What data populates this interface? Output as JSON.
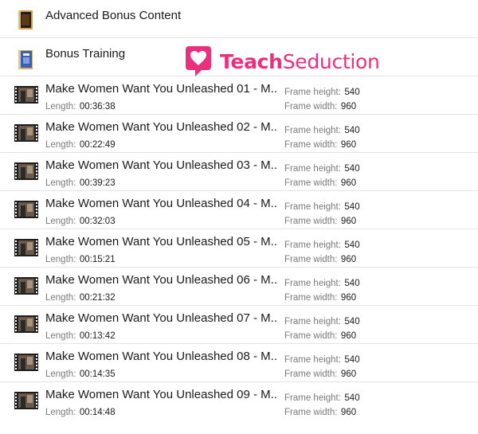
{
  "folders": [
    {
      "name": "Advanced Bonus Content",
      "icon": "dark-folder-icon"
    },
    {
      "name": "Bonus Training",
      "icon": "book-folder-icon"
    }
  ],
  "labels": {
    "length": "Length:",
    "frame_height": "Frame height:",
    "frame_width": "Frame width:"
  },
  "videos": [
    {
      "title": "Make Women Want You Unleashed 01 - M...",
      "length": "00:36:38",
      "frame_height": "540",
      "frame_width": "960"
    },
    {
      "title": "Make Women Want You Unleashed 02 - M...",
      "length": "00:22:49",
      "frame_height": "540",
      "frame_width": "960"
    },
    {
      "title": "Make Women Want You Unleashed 03 - M...",
      "length": "00:39:23",
      "frame_height": "540",
      "frame_width": "960"
    },
    {
      "title": "Make Women Want You Unleashed 04 - M...",
      "length": "00:32:03",
      "frame_height": "540",
      "frame_width": "960"
    },
    {
      "title": "Make Women Want You Unleashed 05 - M...",
      "length": "00:15:21",
      "frame_height": "540",
      "frame_width": "960"
    },
    {
      "title": "Make Women Want You Unleashed 06 - M...",
      "length": "00:21:32",
      "frame_height": "540",
      "frame_width": "960"
    },
    {
      "title": "Make Women Want You Unleashed 07 - M...",
      "length": "00:13:42",
      "frame_height": "540",
      "frame_width": "960"
    },
    {
      "title": "Make Women Want You Unleashed 08 - M...",
      "length": "00:14:35",
      "frame_height": "540",
      "frame_width": "960"
    },
    {
      "title": "Make Women Want You Unleashed 09 - M...",
      "length": "00:14:48",
      "frame_height": "540",
      "frame_width": "960"
    }
  ],
  "watermark": {
    "text_bold": "Teach",
    "text_regular": "Seduction",
    "color": "#ec2f7c",
    "icon": "heart-speech-bubble-icon"
  },
  "colors": {
    "text": "#1a1a1a",
    "label": "#7a7a7a",
    "divider": "#e3e3e3"
  }
}
